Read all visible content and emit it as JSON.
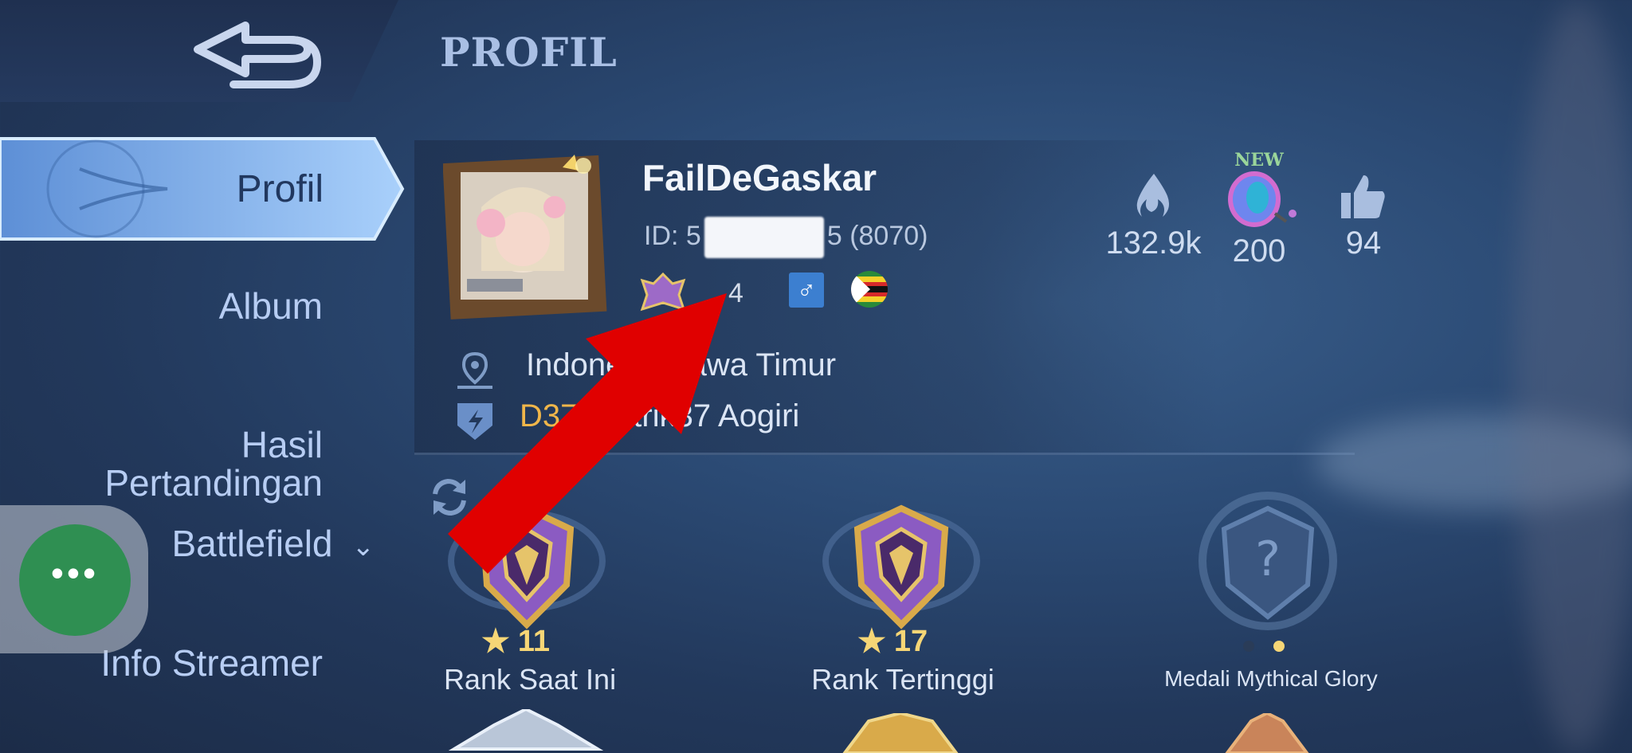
{
  "header": {
    "title": "PROFIL",
    "back_icon": "back-arrow-icon"
  },
  "sidebar": {
    "items": [
      {
        "label": "Profil",
        "active": true
      },
      {
        "label": "Album"
      },
      {
        "label": "Hasil\nPertandingan"
      },
      {
        "label": "Battlefield",
        "has_dropdown": true
      },
      {
        "label": "Info Streamer"
      }
    ]
  },
  "profile": {
    "username": "FailDeGaskar",
    "id_prefix": "ID: 5",
    "id_suffix": "5",
    "server": "(8070)",
    "level": "4",
    "gender": "♂",
    "location": "Indonesia/Jawa Timur",
    "squad_tag": "D37",
    "squad_name": "Distrik37 Aogiri"
  },
  "stats": [
    {
      "icon": "flame-icon",
      "value": "132.9k"
    },
    {
      "icon": "new-coin-badge-icon",
      "badge": "NEW",
      "value": "200"
    },
    {
      "icon": "thumbs-up-icon",
      "value": "94"
    }
  ],
  "medals": [
    {
      "label": "Rank Saat Ini",
      "stars": "11"
    },
    {
      "label": "Rank Tertinggi",
      "stars": "17"
    },
    {
      "label": "Medali Mythical Glory"
    }
  ],
  "colors": {
    "accent_active": "#7fb3f0",
    "annotation_arrow": "#e00000",
    "star": "#f6d676"
  }
}
